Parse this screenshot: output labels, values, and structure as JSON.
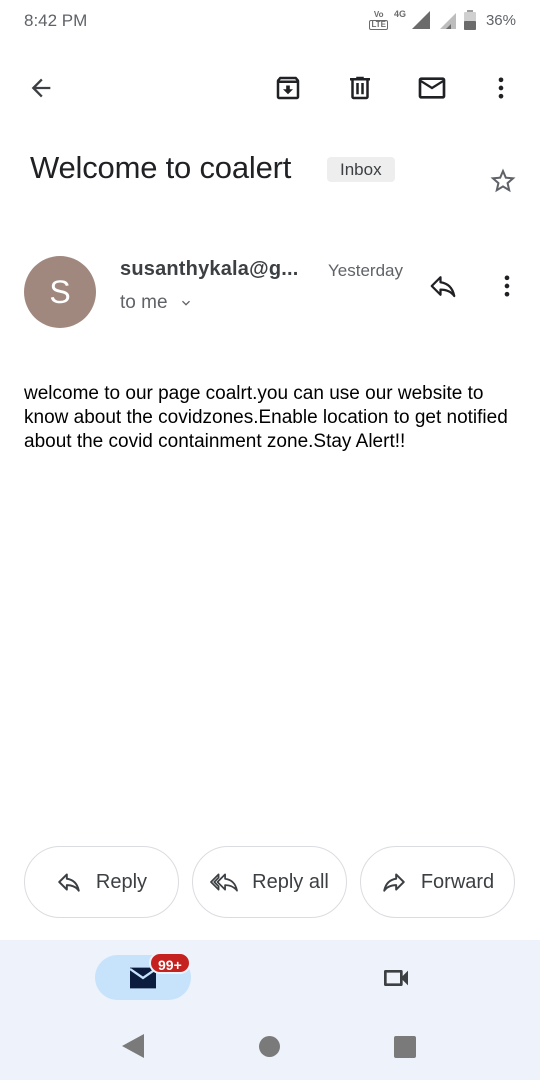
{
  "status_bar": {
    "time": "8:42 PM",
    "volte_top": "VoLTE",
    "volte_bottom": "LTE",
    "network": "4G",
    "battery": "36%"
  },
  "app_bar": {
    "back_icon": "arrow-back-icon",
    "archive_icon": "archive-icon",
    "delete_icon": "trash-icon",
    "unread_icon": "mail-icon",
    "more_icon": "more-vert-icon"
  },
  "email": {
    "subject": "Welcome to coalert",
    "label": "Inbox",
    "avatar_letter": "S",
    "avatar_color": "#a1887f",
    "sender": "susanthykala@g...",
    "date": "Yesterday",
    "recipient": "to me",
    "body": "welcome to our page coalrt.you can use our website to know about the covidzones.Enable location to get notified about the covid containment zone.Stay Alert!!"
  },
  "actions": {
    "reply": "Reply",
    "reply_all": "Reply all",
    "forward": "Forward"
  },
  "bottom_nav": {
    "mail_badge": "99+",
    "mail_icon": "mail-icon",
    "meet_icon": "video-camera-icon",
    "active_color": "#c7e3fb",
    "badge_color": "#c5221f"
  }
}
